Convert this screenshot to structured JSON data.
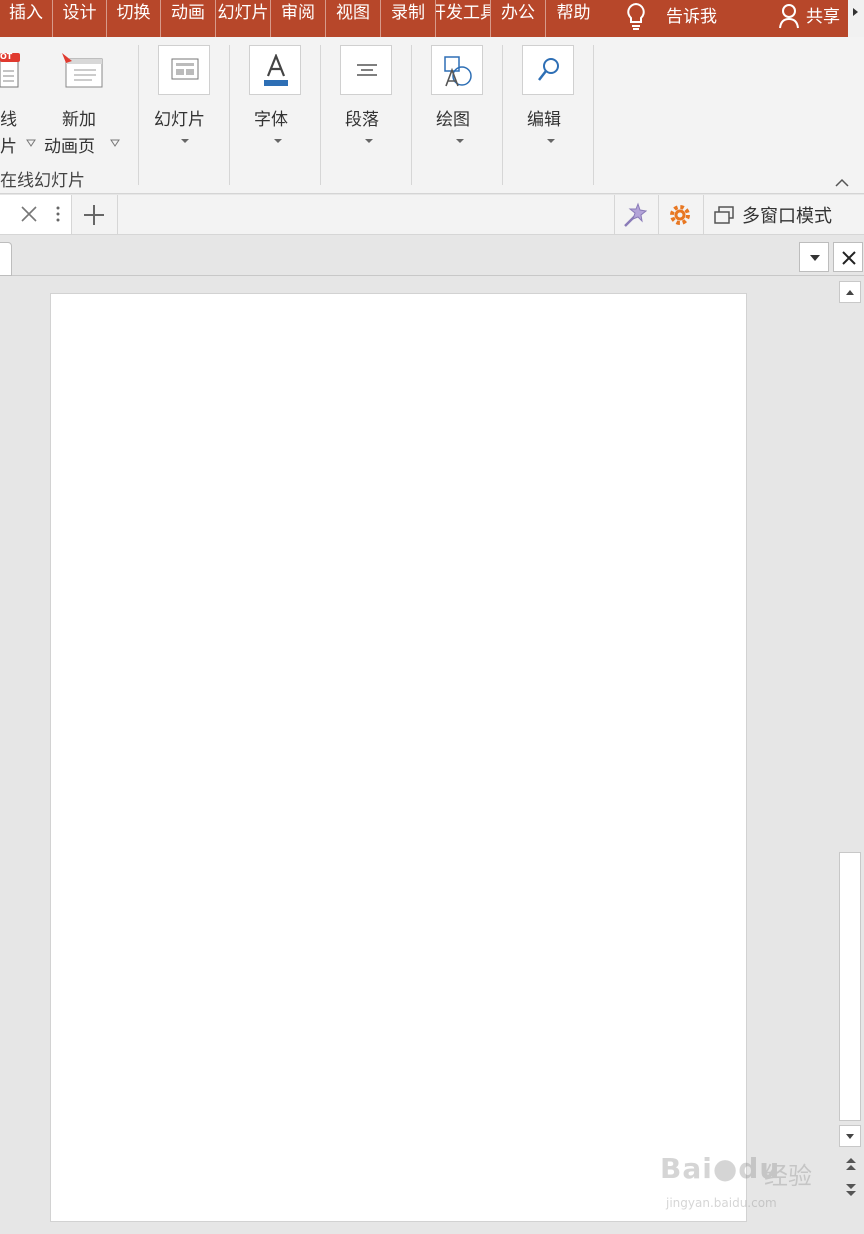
{
  "menu": {
    "tabs": [
      "插入",
      "设计",
      "切换",
      "动画",
      "幻灯片",
      "审阅",
      "视图",
      "录制",
      "开发工具",
      "办公",
      "帮助"
    ],
    "tell_me": "告诉我",
    "share": "共享"
  },
  "ribbon": {
    "online_slides": {
      "line1": "线",
      "line2": "片",
      "group_label": "在线幻灯片",
      "badge": "OT"
    },
    "new_anim_page": {
      "line1": "新加",
      "line2": "动画页"
    },
    "slides_group": "幻灯片",
    "font_group": "字体",
    "paragraph_group": "段落",
    "drawing_group": "绘图",
    "editing_group": "编辑"
  },
  "tabbar": {
    "multi_window": "多窗口模式"
  },
  "watermark": {
    "brand": "Bai",
    "brand2": "du",
    "cn": "经验",
    "url": "jingyan.baidu.com"
  },
  "colors": {
    "accent": "#b7472a",
    "ribbon_bg": "#f3f3f3",
    "workspace_bg": "#e6e6e6"
  }
}
